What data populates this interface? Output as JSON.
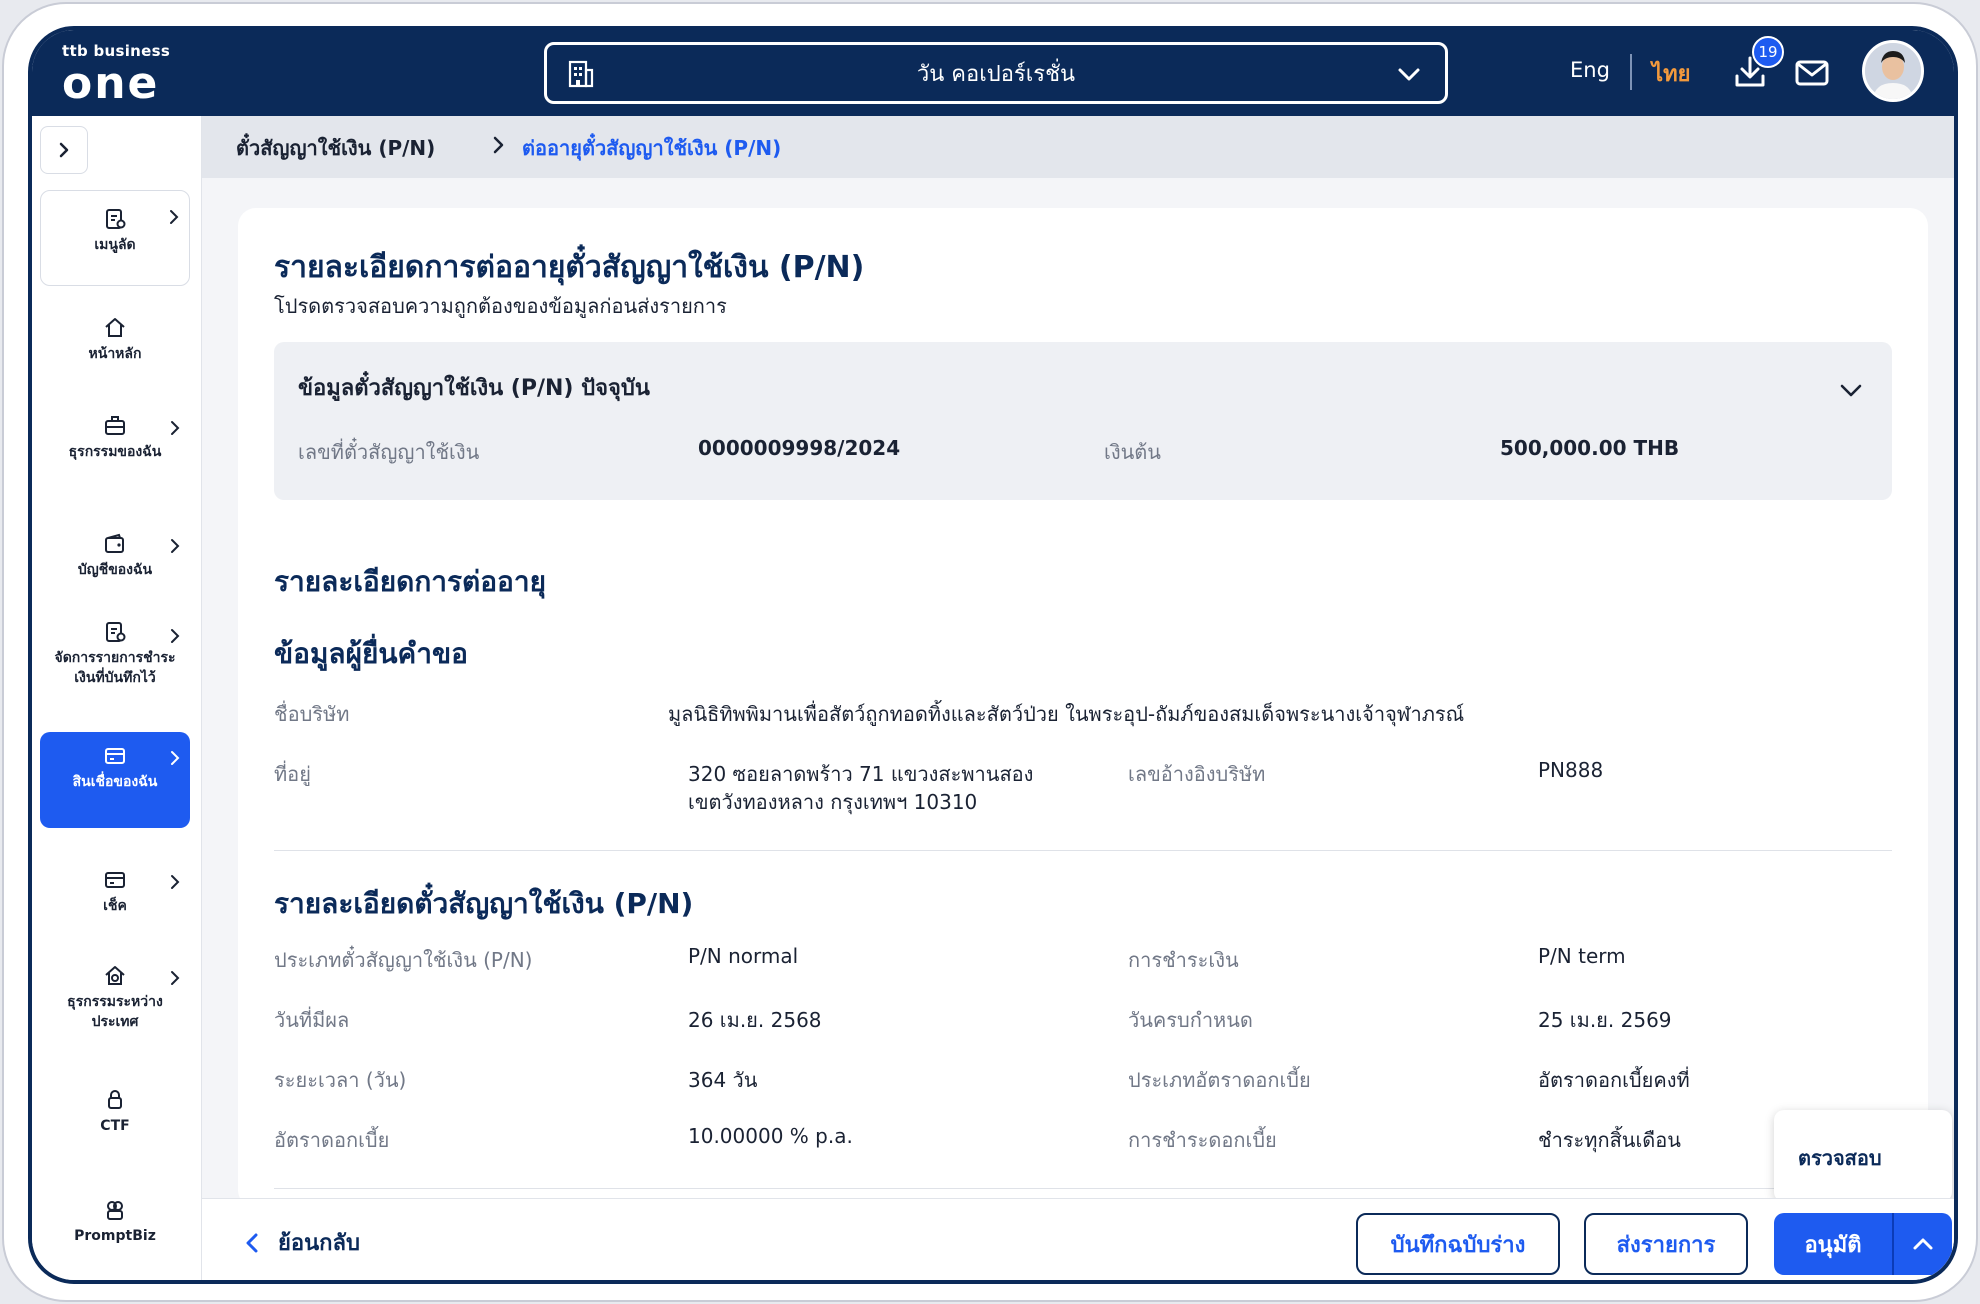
{
  "header": {
    "logo_small": "ttb business",
    "logo_big": "one",
    "company": "วัน คอเปอร์เรชั่น",
    "lang_en": "Eng",
    "lang_th": "ไทย",
    "download_badge": "19"
  },
  "sidebar": {
    "items": [
      {
        "label": "เมนูลัด",
        "icon": "shortcut-icon"
      },
      {
        "label": "หน้าหลัก",
        "icon": "home-icon"
      },
      {
        "label": "ธุรกรรมของฉัน",
        "icon": "briefcase-icon"
      },
      {
        "label": "บัญชีของฉัน",
        "icon": "wallet-icon"
      },
      {
        "label": "จัดการรายการชำระเงินที่บันทึกไว้",
        "icon": "document-icon"
      },
      {
        "label": "สินเชื่อของฉัน",
        "icon": "loan-icon"
      },
      {
        "label": "เช็ค",
        "icon": "cheque-icon"
      },
      {
        "label": "ธุรกรรมระหว่างประเทศ",
        "icon": "global-icon"
      },
      {
        "label": "CTF",
        "icon": "lock-icon"
      },
      {
        "label": "PromptBiz",
        "icon": "promptbiz-icon"
      }
    ]
  },
  "breadcrumb": {
    "item1": "ตั๋วสัญญาใช้เงิน (P/N)",
    "item2": "ต่ออายุตั๋วสัญญาใช้เงิน (P/N)"
  },
  "page": {
    "title": "รายละเอียดการต่ออายุตั๋วสัญญาใช้เงิน (P/N)",
    "subtitle": "โปรดตรวจสอบความถูกต้องของข้อมูลก่อนส่งรายการ"
  },
  "current": {
    "title": "ข้อมูลตั๋วสัญญาใช้เงิน (P/N) ปัจจุบัน",
    "pn_no_label": "เลขที่ตั๋วสัญญาใช้เงิน",
    "pn_no_value": "0000009998/2024",
    "principal_label": "เงินต้น",
    "principal_value": "500,000.00 THB"
  },
  "renewal": {
    "title": "รายละเอียดการต่ออายุ"
  },
  "applicant": {
    "title": "ข้อมูลผู้ยื่นคำขอ",
    "company_label": "ชื่อบริษัท",
    "company_value": "มูลนิธิทิพพิมานเพื่อสัตว์ถูกทอดทิ้งและสัตว์ป่วย ในพระอุป-ถัมภ์ของสมเด็จพระนางเจ้าจุฬาภรณ์",
    "address_label": "ที่อยู่",
    "address_line1": "320 ซอยลาดพร้าว 71 แขวงสะพานสอง",
    "address_line2": "เขตวังทองหลาง กรุงเทพฯ 10310",
    "ref_label": "เลขอ้างอิงบริษัท",
    "ref_value": "PN888"
  },
  "pn_details": {
    "title": "รายละเอียดตั๋วสัญญาใช้เงิน (P/N)",
    "rows": [
      {
        "l1": "ประเภทตั๋วสัญญาใช้เงิน (P/N)",
        "v1": "P/N normal",
        "l2": "การชำระเงิน",
        "v2": "P/N term"
      },
      {
        "l1": "วันที่มีผล",
        "v1": "26 เม.ย. 2568",
        "l2": "วันครบกำหนด",
        "v2": "25 เม.ย. 2569"
      },
      {
        "l1": "ระยะเวลา (วัน)",
        "v1": "364 วัน",
        "l2": "ประเภทอัตราดอกเบี้ย",
        "v2": "อัตราดอกเบี้ยคงที่"
      },
      {
        "l1": "อัตราดอกเบี้ย",
        "v1": "10.00000 % p.a.",
        "l2": "การชำระดอกเบี้ย",
        "v2": "ชำระทุกสิ้นเดือน"
      }
    ]
  },
  "actions": {
    "back": "ย้อนกลับ",
    "save_draft": "บันทึกฉบับร่าง",
    "submit": "ส่งรายการ",
    "approve": "อนุมัติ",
    "popup_review": "ตรวจสอบ"
  },
  "colors": {
    "navy": "#0b2a59",
    "primary": "#1e5bf0",
    "accent_orange": "#f39a3d"
  }
}
